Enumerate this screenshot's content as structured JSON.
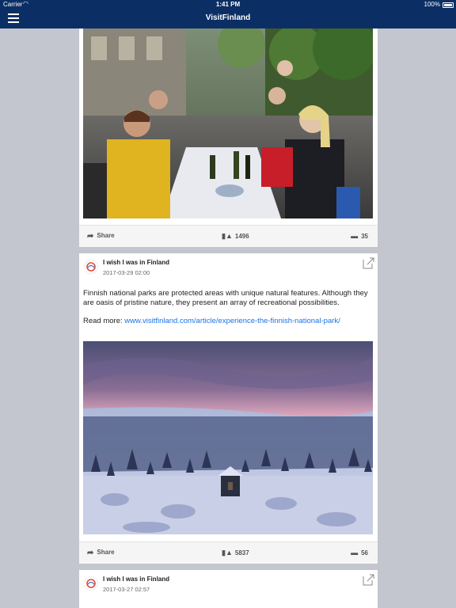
{
  "status": {
    "carrier": "Carrier",
    "time": "1:41 PM",
    "battery": "100%"
  },
  "nav": {
    "title": "VisitFinland"
  },
  "feed": [
    {
      "actions": {
        "share": "Share",
        "likes": "1496",
        "comments": "35"
      }
    },
    {
      "author": "I wish I was in Finland",
      "date": "2017-03-29 02:00",
      "text": "Finnish national parks are protected areas with unique natural features. Although they are oasis of pristine nature, they present an array of recreational possibilities.",
      "read_more_label": "Read more:",
      "link": "www.visitfinland.com/article/experience-the-finnish-national-park/",
      "actions": {
        "share": "Share",
        "likes": "5837",
        "comments": "56"
      }
    },
    {
      "author": "I wish I was in Finland",
      "date": "2017-03-27 02:57"
    }
  ],
  "icons": {
    "menu": "hamburger-icon",
    "share": "share-arrow-icon",
    "like": "thumbs-up-icon",
    "comment": "comment-icon",
    "external": "external-link-icon"
  },
  "colors": {
    "navbar": "#0b2f64",
    "link": "#1a73e8",
    "background": "#c3c6ce"
  }
}
